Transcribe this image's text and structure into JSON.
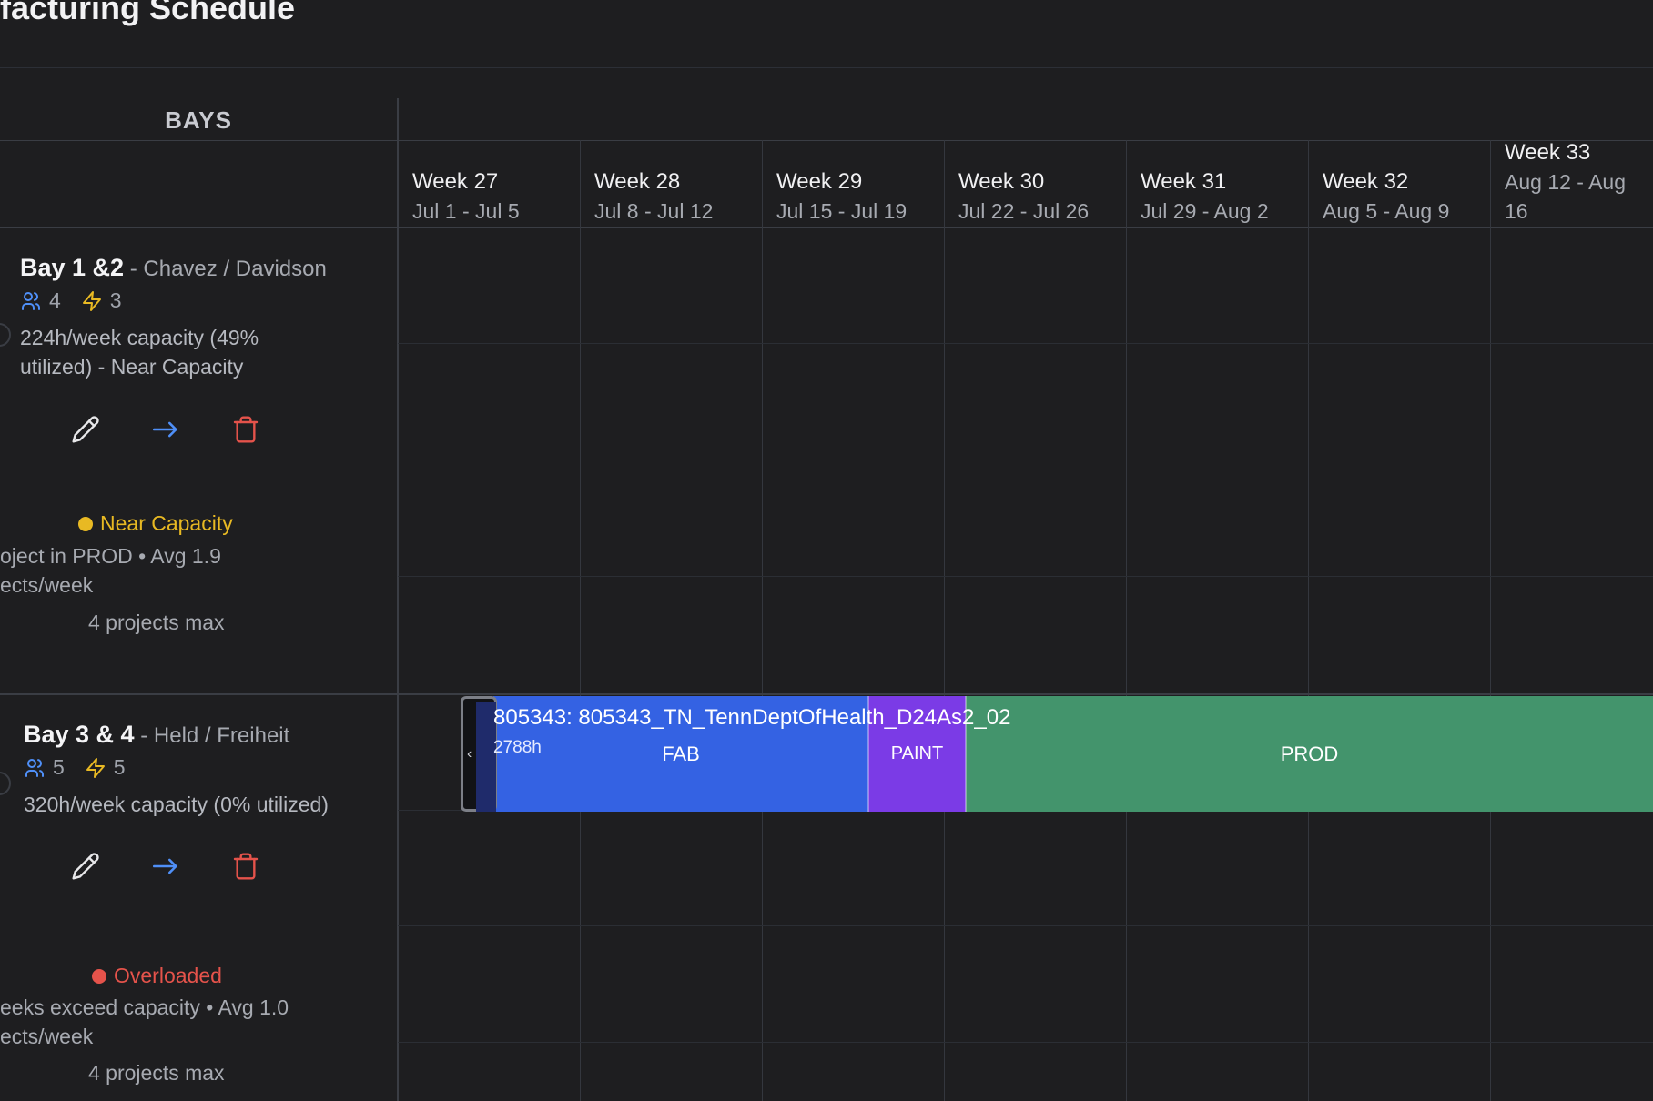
{
  "page": {
    "title": "ufacturing Schedule"
  },
  "sidebar": {
    "header": "BAYS"
  },
  "weeks": [
    {
      "label": "Week 27",
      "range": "Jul 1 - Jul 5"
    },
    {
      "label": "Week 28",
      "range": "Jul 8 - Jul 12"
    },
    {
      "label": "Week 29",
      "range": "Jul 15 - Jul 19"
    },
    {
      "label": "Week 30",
      "range": "Jul 22 - Jul 26"
    },
    {
      "label": "Week 31",
      "range": "Jul 29 - Aug 2"
    },
    {
      "label": "Week 32",
      "range": "Aug 5 - Aug 9"
    },
    {
      "label": "Week 33",
      "range_line1": "Aug 12 - Aug",
      "range_line2": "16"
    }
  ],
  "bays": [
    {
      "name": "Bay 1 &2",
      "leads": " - Chavez / Davidson",
      "staff_count": "4",
      "power_count": "3",
      "capacity_line1": "224h/week capacity (49%",
      "capacity_line2": "utilized) - Near Capacity",
      "status": "Near Capacity",
      "status_color": "#e8b923",
      "detail_line1": "oject in PROD • Avg 1.9",
      "detail_line2": "ects/week",
      "max_projects": "4 projects max"
    },
    {
      "name": "Bay 3 & 4",
      "leads": " - Held / Freiheit",
      "staff_count": "5",
      "power_count": "5",
      "capacity_line1": "320h/week capacity (0% utilized)",
      "status": "Overloaded",
      "status_color": "#e5534b",
      "detail_line1": "eeks exceed capacity • Avg 1.0",
      "detail_line2": "ects/week",
      "max_projects": "4 projects max"
    }
  ],
  "project": {
    "title": "805343: 805343_TN_TennDeptOfHealth_D24As2_02",
    "hours": "2788h",
    "phases": [
      {
        "name": "FAB",
        "color": "#3462e3"
      },
      {
        "name": "PAINT",
        "color": "#7b3be6"
      },
      {
        "name": "PROD",
        "color": "#43946c"
      }
    ]
  },
  "colors": {
    "accent_blue": "#4f8ff7",
    "warning": "#e8b923",
    "danger": "#e5534b",
    "delete": "#e5534b"
  }
}
